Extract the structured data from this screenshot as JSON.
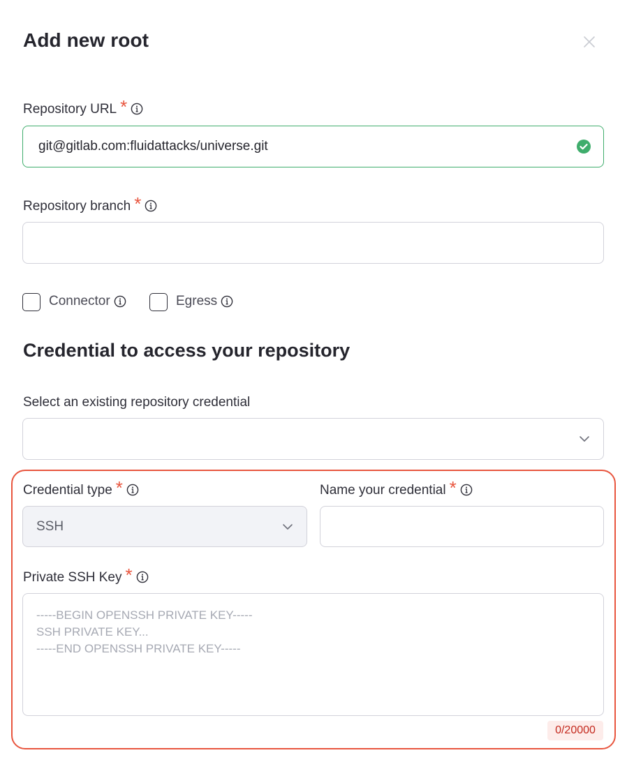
{
  "modal": {
    "title": "Add new root",
    "close_icon": "close-icon"
  },
  "repo_url": {
    "label": "Repository URL",
    "required_mark": "*",
    "value": "git@gitlab.com:fluidattacks/universe.git",
    "status": "valid"
  },
  "repo_branch": {
    "label": "Repository branch",
    "required_mark": "*",
    "value": ""
  },
  "options": {
    "connector_label": "Connector",
    "connector_checked": false,
    "egress_label": "Egress",
    "egress_checked": false
  },
  "credential_section": {
    "title": "Credential to access your repository",
    "existing_label": "Select an existing repository credential",
    "existing_value": ""
  },
  "credential_type": {
    "label": "Credential type",
    "required_mark": "*",
    "value": "SSH"
  },
  "credential_name": {
    "label": "Name your credential",
    "required_mark": "*",
    "value": ""
  },
  "ssh_key": {
    "label": "Private SSH Key",
    "required_mark": "*",
    "placeholder": "-----BEGIN OPENSSH PRIVATE KEY-----\nSSH PRIVATE KEY...\n-----END OPENSSH PRIVATE KEY-----",
    "counter": "0/20000"
  },
  "colors": {
    "required": "#e8553e",
    "valid": "#3fad6c",
    "highlight": "#e8553e",
    "counter_text": "#c4291e"
  }
}
